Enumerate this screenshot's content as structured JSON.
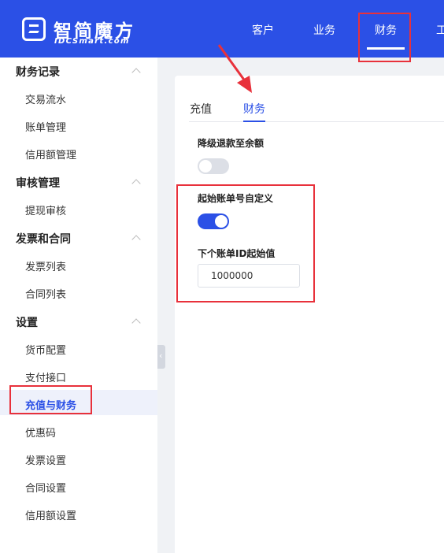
{
  "header": {
    "logo_cn": "智简魔方",
    "logo_en": "IDCSmart.com",
    "nav": [
      "客户",
      "业务",
      "财务",
      "工"
    ]
  },
  "sidebar": {
    "groups": [
      {
        "title": "财务记录",
        "items": [
          "交易流水",
          "账单管理",
          "信用额管理"
        ]
      },
      {
        "title": "审核管理",
        "items": [
          "提现审核"
        ]
      },
      {
        "title": "发票和合同",
        "items": [
          "发票列表",
          "合同列表"
        ]
      },
      {
        "title": "设置",
        "items": [
          "货币配置",
          "支付接口",
          "充值与财务",
          "优惠码",
          "发票设置",
          "合同设置",
          "信用额设置"
        ]
      }
    ]
  },
  "main": {
    "tabs": [
      "充值",
      "财务"
    ],
    "settings": {
      "downgrade_label": "降级退款至余额",
      "custom_bill_label": "起始账单号自定义",
      "next_bill_id_label": "下个账单ID起始值",
      "next_bill_id_value": "1000000"
    }
  },
  "colors": {
    "primary": "#2b50e6",
    "annotation": "#e8313b"
  }
}
